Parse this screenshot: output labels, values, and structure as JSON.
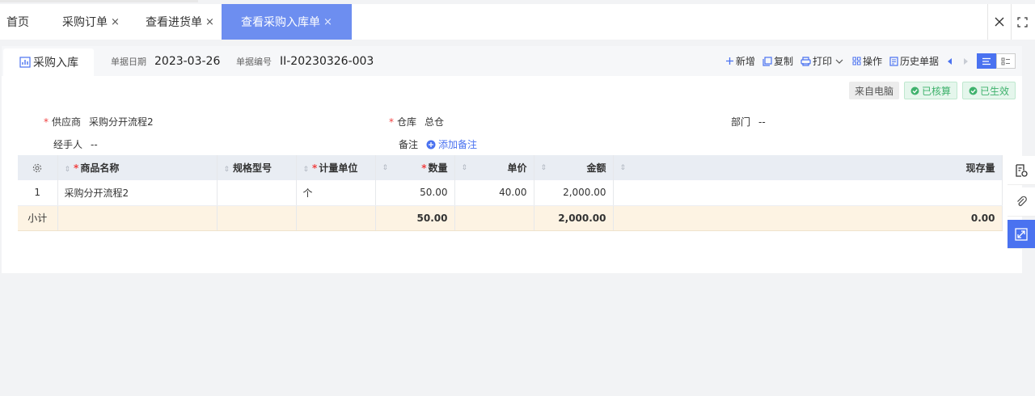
{
  "tabs": [
    {
      "label": "首页",
      "closable": false,
      "active": false
    },
    {
      "label": "采购订单",
      "closable": true,
      "active": false
    },
    {
      "label": "查看进货单",
      "closable": true,
      "active": false
    },
    {
      "label": "查看采购入库单",
      "closable": true,
      "active": true
    }
  ],
  "close_glyph": "×",
  "header": {
    "title": "采购入库",
    "date_label": "单据日期",
    "date_value": "2023-03-26",
    "no_label": "单据编号",
    "no_value": "II-20230326-003"
  },
  "toolbar": {
    "add": "新增",
    "copy": "复制",
    "print": "打印",
    "operate": "操作",
    "history": "历史单据"
  },
  "badges": {
    "source": "来自电脑",
    "audited": "已核算",
    "effective": "已生效"
  },
  "form": {
    "supplier_label": "供应商",
    "supplier_value": "采购分开流程2",
    "warehouse_label": "仓库",
    "warehouse_value": "总仓",
    "dept_label": "部门",
    "dept_value": "--",
    "handler_label": "经手人",
    "handler_value": "--",
    "remark_label": "备注",
    "remark_add": "添加备注"
  },
  "table": {
    "columns": {
      "name": "商品名称",
      "spec": "规格型号",
      "unit": "计量单位",
      "qty": "数量",
      "price": "单价",
      "amount": "金额",
      "stock": "现存量"
    },
    "rows": [
      {
        "index": "1",
        "name": "采购分开流程2",
        "spec": "",
        "unit": "个",
        "qty": "50.00",
        "price": "40.00",
        "amount": "2,000.00",
        "stock": ""
      }
    ],
    "subtotal": {
      "label": "小计",
      "qty": "50.00",
      "amount": "2,000.00",
      "stock": "0.00"
    }
  },
  "colors": {
    "accent": "#4a72f0",
    "active_tab": "#6d8ef0",
    "required": "#f04040",
    "success": "#3fb26d",
    "subtotal_bg": "#fdf3e3"
  },
  "icons": [
    "chart-icon",
    "plus-icon",
    "copy-icon",
    "printer-icon",
    "chevron-down-icon",
    "grid-icon",
    "document-icon",
    "caret-left-icon",
    "caret-right-icon",
    "list-view-icon",
    "detail-view-icon",
    "check-circle-icon",
    "plus-circle-icon",
    "gear-icon",
    "sort-icon",
    "close-icon",
    "fullscreen-icon",
    "audit-icon",
    "attachment-icon",
    "expand-icon"
  ]
}
